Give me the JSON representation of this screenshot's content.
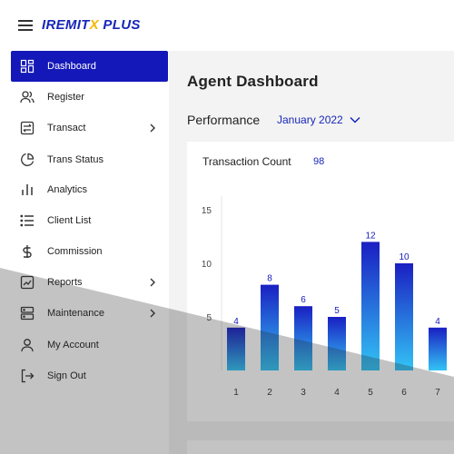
{
  "app": {
    "logo_prefix": "IREMIT",
    "logo_x": "X",
    "logo_suffix": " PLUS"
  },
  "sidebar": {
    "items": [
      {
        "label": "Dashboard",
        "icon": "dashboard-icon",
        "active": true
      },
      {
        "label": "Register",
        "icon": "users-icon"
      },
      {
        "label": "Transact",
        "icon": "transact-icon",
        "has_children": true
      },
      {
        "label": "Trans Status",
        "icon": "pie-chart-icon"
      },
      {
        "label": "Analytics",
        "icon": "bar-chart-icon"
      },
      {
        "label": "Client List",
        "icon": "list-icon"
      },
      {
        "label": "Commission",
        "icon": "dollar-icon"
      },
      {
        "label": "Reports",
        "icon": "line-chart-icon",
        "has_children": true
      },
      {
        "label": "Maintenance",
        "icon": "server-icon",
        "has_children": true
      },
      {
        "label": "My Account",
        "icon": "user-icon"
      },
      {
        "label": "Sign Out",
        "icon": "sign-out-icon"
      }
    ]
  },
  "main": {
    "title": "Agent Dashboard",
    "performance_label": "Performance",
    "month": "January 2022"
  },
  "card": {
    "transaction_count_label": "Transaction Count",
    "transaction_count_value": "98"
  },
  "colors": {
    "accent": "#1418b8",
    "bar_top": "#1a1fc2",
    "bar_bottom": "#33c4f5"
  },
  "chart_data": {
    "type": "bar",
    "categories": [
      "1",
      "2",
      "3",
      "4",
      "5",
      "6",
      "7"
    ],
    "values": [
      4,
      8,
      6,
      5,
      12,
      10,
      4
    ],
    "yticks": [
      5,
      10,
      15
    ],
    "ylim": [
      0,
      15
    ],
    "title": "",
    "xlabel": "",
    "ylabel": ""
  }
}
